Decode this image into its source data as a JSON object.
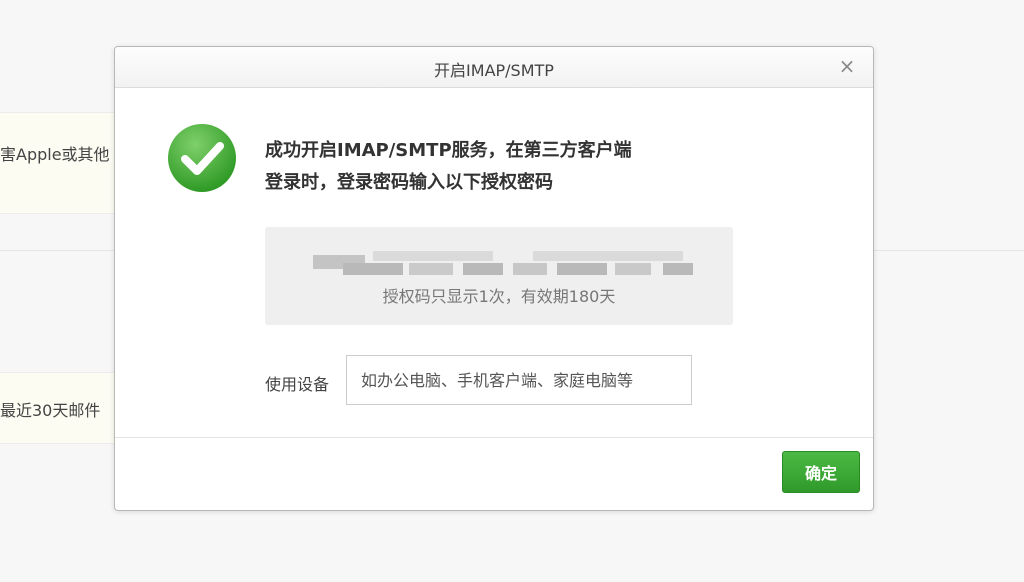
{
  "background": {
    "fragment_1": "害Apple或其他",
    "fragment_2": "最近30天邮件"
  },
  "dialog": {
    "title": "开启IMAP/SMTP",
    "close_icon": "×",
    "message_line_1": "成功开启IMAP/SMTP服务，在第三方客户端",
    "message_line_2": "登录时，登录密码输入以下授权密码",
    "code_note": "授权码只显示1次，有效期180天",
    "device_label": "使用设备",
    "device_placeholder": "如办公电脑、手机客户端、家庭电脑等",
    "confirm_label": "确定"
  },
  "colors": {
    "accent_green": "#3aa834",
    "success_icon": "#4aad3c"
  },
  "icons": [
    "success-check-icon",
    "close-icon"
  ]
}
